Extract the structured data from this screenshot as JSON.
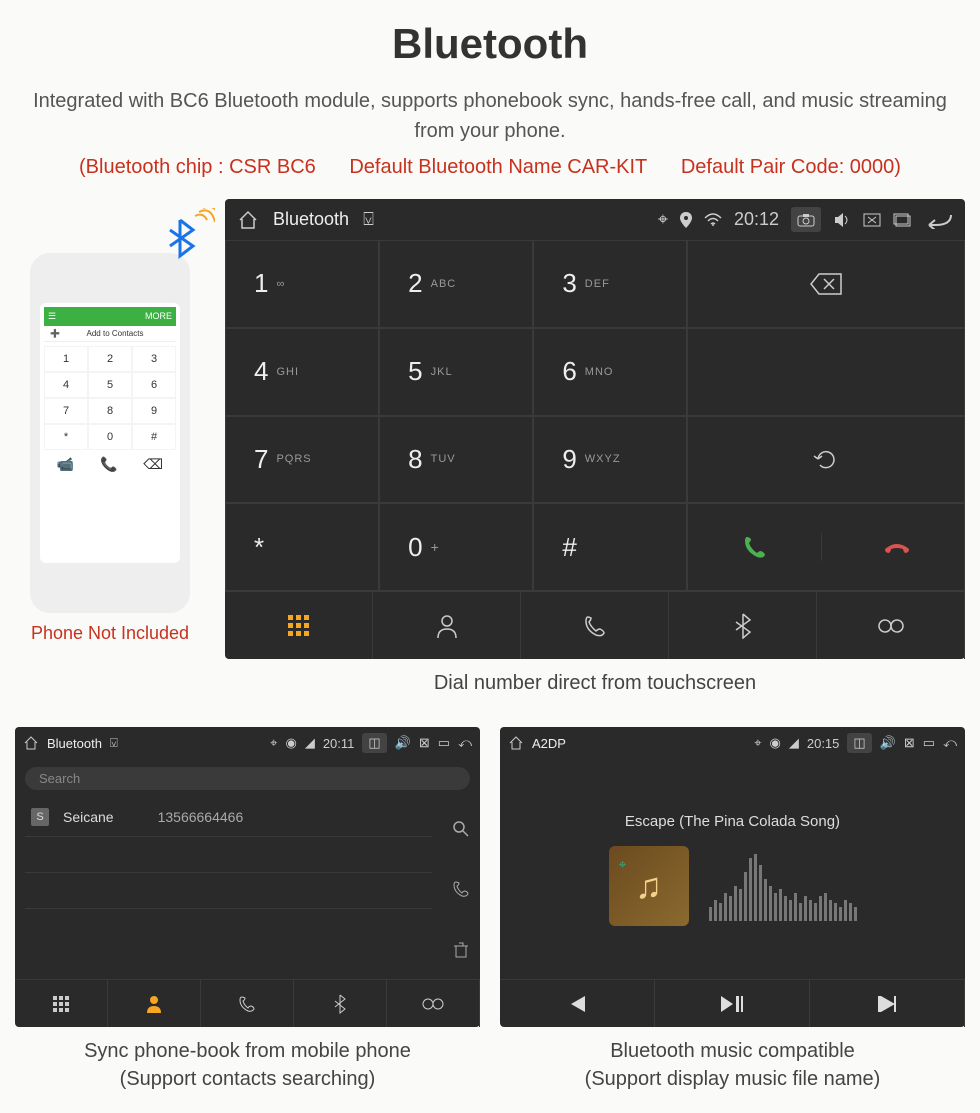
{
  "title": "Bluetooth",
  "subtitle": "Integrated with BC6 Bluetooth module, supports phonebook sync, hands-free call, and music streaming from your phone.",
  "specs": {
    "chip": "(Bluetooth chip : CSR BC6",
    "name": "Default Bluetooth Name CAR-KIT",
    "pair": "Default Pair Code: 0000)"
  },
  "phone_note": "Phone Not Included",
  "phone_mock": {
    "header_left": "Add to Contacts",
    "header_right": "MORE",
    "keys": [
      "1",
      "2",
      "3",
      "4",
      "5",
      "6",
      "7",
      "8",
      "9",
      "*",
      "0",
      "#"
    ]
  },
  "dialer": {
    "statusbar": {
      "title": "Bluetooth",
      "time": "20:12"
    },
    "keys": [
      {
        "n": "1",
        "s": "∞"
      },
      {
        "n": "2",
        "s": "ABC"
      },
      {
        "n": "3",
        "s": "DEF"
      },
      {
        "n": "4",
        "s": "GHI"
      },
      {
        "n": "5",
        "s": "JKL"
      },
      {
        "n": "6",
        "s": "MNO"
      },
      {
        "n": "7",
        "s": "PQRS"
      },
      {
        "n": "8",
        "s": "TUV"
      },
      {
        "n": "9",
        "s": "WXYZ"
      },
      {
        "n": "*",
        "s": ""
      },
      {
        "n": "0",
        "s": "+"
      },
      {
        "n": "#",
        "s": ""
      }
    ],
    "caption": "Dial number direct from touchscreen"
  },
  "phonebook": {
    "statusbar": {
      "title": "Bluetooth",
      "time": "20:11"
    },
    "search_placeholder": "Search",
    "contact": {
      "badge": "S",
      "name": "Seicane",
      "number": "13566664466"
    },
    "caption_l1": "Sync phone-book from mobile phone",
    "caption_l2": "(Support contacts searching)"
  },
  "music": {
    "statusbar": {
      "title": "A2DP",
      "time": "20:15"
    },
    "track": "Escape (The Pina Colada Song)",
    "caption_l1": "Bluetooth music compatible",
    "caption_l2": "(Support display music file name)"
  }
}
